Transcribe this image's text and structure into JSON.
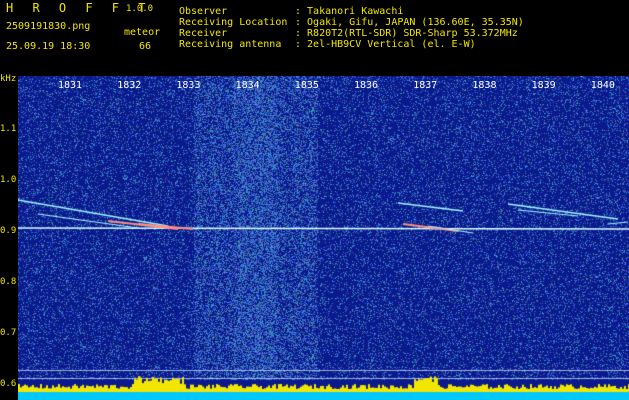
{
  "header": {
    "app_title": "H R O F F T",
    "version": "1.0.0",
    "filename": "2509191830.png",
    "timestamp": "25.09.19 18:30",
    "count_label": "meteor",
    "count_value": "66",
    "fields": [
      {
        "label": "Observer",
        "value": ": Takanori Kawachi"
      },
      {
        "label": "Receiving Location",
        "value": ": Ogaki, Gifu, JAPAN (136.60E, 35.35N)"
      },
      {
        "label": "Receiver",
        "value": ": R820T2(RTL-SDR) SDR-Sharp 53.372MHz"
      },
      {
        "label": "Receiving antenna",
        "value": ": 2el-HB9CV Vertical (el. E-W)"
      }
    ]
  },
  "chart_data": {
    "type": "heatmap",
    "ylabel": "kHz",
    "y_ticks": [
      "1.1",
      "1.0",
      "0.9",
      "0.8",
      "0.7",
      "0.6"
    ],
    "x_ticks": [
      "1831",
      "1832",
      "1833",
      "1834",
      "1835",
      "1836",
      "1837",
      "1838",
      "1839",
      "1840"
    ],
    "colors": {
      "background": "#0a1a8c",
      "noise": "#3f7cff",
      "carrier": "#d8ffff",
      "meteor": "#ff9080",
      "histogram": "#f2e600",
      "base": "#00c8ff"
    }
  }
}
